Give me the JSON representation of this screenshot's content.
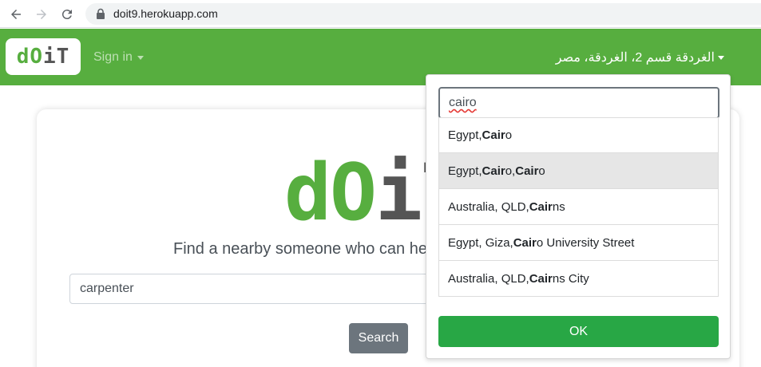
{
  "browser": {
    "url": "doit9.herokuapp.com"
  },
  "navbar": {
    "brand_left": "dO",
    "brand_right": "iT",
    "signin_label": "Sign in",
    "location_label": "الغردقة قسم 2، الغردقة، مصر",
    "accent_color": "#57ae3f"
  },
  "main": {
    "logo_left": "dO",
    "logo_right": "iT",
    "tagline": "Find a nearby someone who can help",
    "search_value": "carpenter",
    "search_button": "Search"
  },
  "location_popup": {
    "input_value": "cairo",
    "results": [
      {
        "prefix": "Egypt, ",
        "match": "Cair",
        "suffix": "o",
        "extra_match": "",
        "extra_suffix": ""
      },
      {
        "prefix": "Egypt, ",
        "match": "Cair",
        "suffix": "o, ",
        "extra_match": "Cair",
        "extra_suffix": "o"
      },
      {
        "prefix": "Australia, QLD, ",
        "match": "Cair",
        "suffix": "ns",
        "extra_match": "",
        "extra_suffix": ""
      },
      {
        "prefix": "Egypt, Giza, ",
        "match": "Cair",
        "suffix": "o University Street",
        "extra_match": "",
        "extra_suffix": ""
      },
      {
        "prefix": "Australia, QLD, ",
        "match": "Cair",
        "suffix": "ns City",
        "extra_match": "",
        "extra_suffix": ""
      }
    ],
    "ok_label": "OK"
  }
}
